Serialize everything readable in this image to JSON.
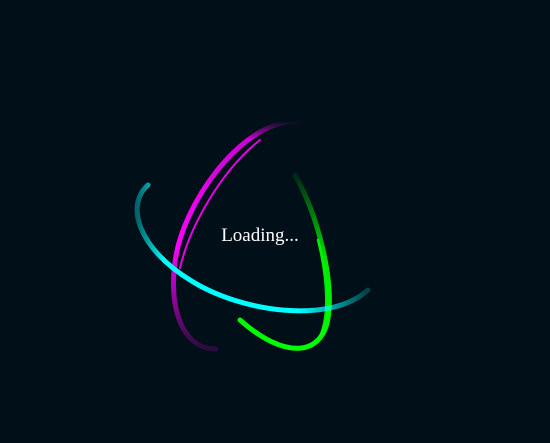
{
  "loader": {
    "text": "Loading...",
    "background_color": "#000f18",
    "text_color": "#ffffff",
    "ring_colors": {
      "magenta": "#ff00ff",
      "cyan": "#00ffff",
      "green": "#00ff00"
    }
  }
}
